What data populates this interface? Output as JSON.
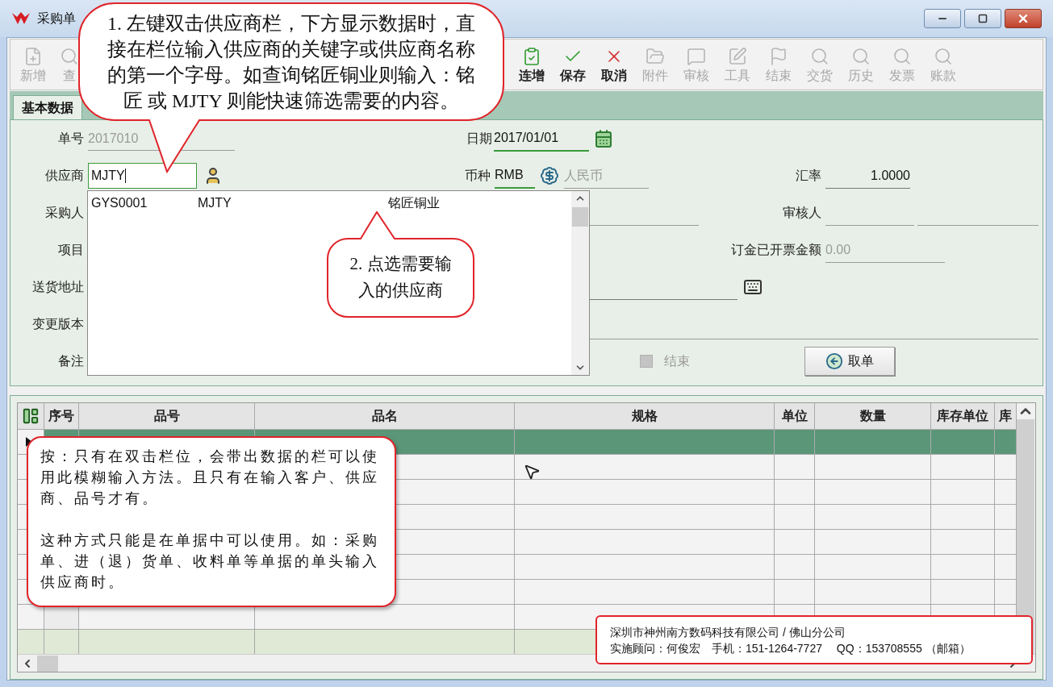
{
  "window": {
    "title": "采购单"
  },
  "toolbar_start": [
    {
      "label": "新增",
      "disabled": true
    },
    {
      "label": "查",
      "disabled": true
    }
  ],
  "toolbar_end": [
    {
      "label": "连增",
      "disabled": false
    },
    {
      "label": "保存",
      "disabled": false
    },
    {
      "label": "取消",
      "disabled": false
    },
    {
      "label": "附件",
      "disabled": true
    },
    {
      "label": "审核",
      "disabled": true
    },
    {
      "label": "工具",
      "disabled": true
    },
    {
      "label": "结束",
      "disabled": true
    },
    {
      "label": "交货",
      "disabled": true
    },
    {
      "label": "历史",
      "disabled": true
    },
    {
      "label": "发票",
      "disabled": true
    },
    {
      "label": "账款",
      "disabled": true
    }
  ],
  "tabs": [
    {
      "label": "基本数据",
      "selected": true
    }
  ],
  "form": {
    "order_no": {
      "label": "单号",
      "value": "2017010",
      "disabled": true
    },
    "supplier": {
      "label": "供应商",
      "value": "MJTY"
    },
    "buyer": {
      "label": "采购人"
    },
    "project": {
      "label": "项目"
    },
    "delivery_address": {
      "label": "送货地址"
    },
    "change_version": {
      "label": "变更版本"
    },
    "remark": {
      "label": "备注"
    },
    "date": {
      "label": "日期",
      "value": "2017/01/01"
    },
    "currency": {
      "label": "币种",
      "value": "RMB",
      "name": "人民币",
      "name_disabled": true
    },
    "rate": {
      "label": "汇率",
      "value": "1.0000"
    },
    "reviewer": {
      "label": "审核人"
    },
    "invoiced_deposit": {
      "label": "订金已开票金额",
      "value": "0.00",
      "disabled": true
    },
    "closed": {
      "label": "结束",
      "checked": false,
      "disabled": true
    },
    "take_order_button": "取单"
  },
  "dropdown": {
    "rows": [
      {
        "cells": [
          "GYS0001",
          "MJTY",
          "铭匠铜业"
        ]
      }
    ]
  },
  "grid": {
    "columns": [
      "序号",
      "品号",
      "品名",
      "规格",
      "单位",
      "数量",
      "库存单位",
      "库"
    ],
    "rows": [
      {
        "selected": true
      },
      {
        "selected": false
      },
      {
        "selected": false
      },
      {
        "selected": false
      },
      {
        "selected": false
      },
      {
        "selected": false
      },
      {
        "selected": false
      },
      {
        "selected": false
      }
    ]
  },
  "callouts": [
    {
      "text": "1. 左键双击供应商栏，下方显示数据时，直接在栏位输入供应商的关键字或供应商名称的第一个字母。如查询铭匠铜业则输入：铭匠 或 MJTY 则能快速筛选需要的内容。"
    },
    {
      "text": "2.  点选需要输入的供应商"
    }
  ],
  "note": {
    "paragraphs": [
      "按：只有在双击栏位，会带出数据的栏可以使用此模糊输入方法。且只有在输入客户、供应商、品号才有。",
      "这种方式只能是在单据中可以使用。如：采购单、进（退）货单、收料单等单据的单头输入供应商时。"
    ]
  },
  "footer": {
    "lines": [
      "深圳市神州南方数码科技有限公司 / 佛山分公司",
      "实施顾问：何俊宏　手机：151-1264-7727　 QQ：153708555 （邮箱）"
    ]
  }
}
